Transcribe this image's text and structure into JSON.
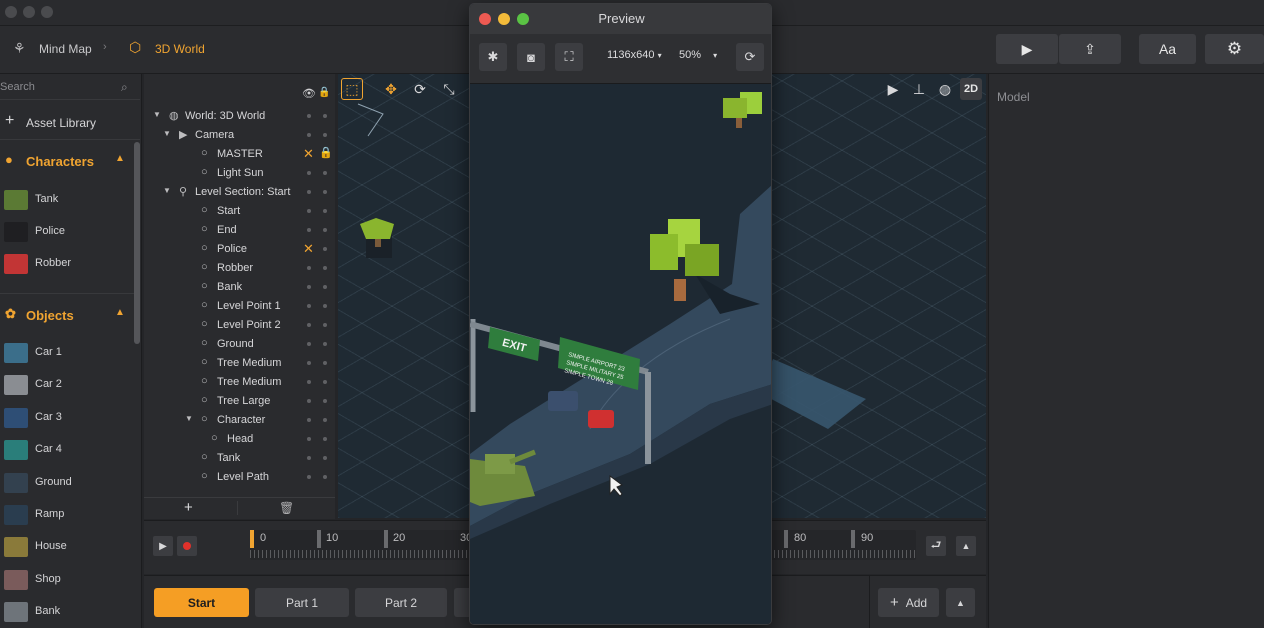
{
  "window": {
    "title": ""
  },
  "breadcrumb": {
    "mind_map": "Mind Map",
    "world": "3D World"
  },
  "top_buttons": {
    "font_label": "Aa"
  },
  "search": {
    "placeholder": "Search"
  },
  "asset_library": {
    "label": "Asset Library"
  },
  "characters": {
    "title": "Characters",
    "items": [
      "Tank",
      "Police",
      "Robber"
    ]
  },
  "objects": {
    "title": "Objects",
    "items": [
      "Car 1",
      "Car 2",
      "Car 3",
      "Car 4",
      "Ground",
      "Ramp",
      "House",
      "Shop",
      "Bank"
    ]
  },
  "tree": {
    "items": [
      "World: 3D World",
      "Camera",
      "MASTER",
      "Light Sun",
      "Level Section: Start",
      "Start",
      "End",
      "Police",
      "Robber",
      "Bank",
      "Level Point 1",
      "Level Point 2",
      "Ground",
      "Tree Medium",
      "Tree Medium",
      "Tree Large",
      "Character",
      "Head",
      "Tank",
      "Level Path"
    ]
  },
  "viewport": {
    "toolbar_2d": "2D"
  },
  "right_panel": {
    "title": "Model"
  },
  "timeline": {
    "ticks": [
      "0",
      "10",
      "20",
      "30",
      "80",
      "90"
    ]
  },
  "parts": {
    "start": "Start",
    "part1": "Part 1",
    "part2": "Part 2",
    "add": "Add"
  },
  "preview": {
    "title": "Preview",
    "resolution": "1136x640",
    "zoom": "50%",
    "sign_exit": "EXIT",
    "sign_lines": [
      "SIMPLE AIRPORT 23",
      "SIMPLE MILITARY 25",
      "SIMPLE TOWN 28"
    ]
  },
  "colors": {
    "accent": "#f0a431",
    "panel": "#2a2b2e",
    "scene": "#1e2933"
  }
}
